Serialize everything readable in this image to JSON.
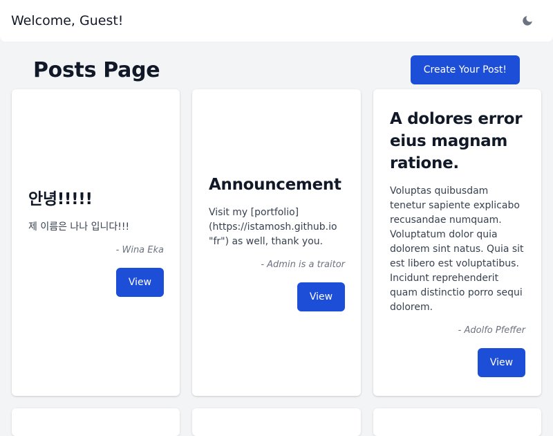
{
  "header": {
    "welcome": "Welcome, Guest!",
    "theme_icon": "moon-icon"
  },
  "page": {
    "title": "Posts Page",
    "create_button": "Create Your Post!"
  },
  "posts": [
    {
      "title": "안녕!!!!!",
      "body": "제 이름은 나나 입니다!!!",
      "author": "- Wina Eka",
      "view_label": "View"
    },
    {
      "title": "Announcement",
      "body": "Visit my [portfolio](https://istamosh.github.io \"fr\") as well, thank you.",
      "author": "- Admin is a traitor",
      "view_label": "View"
    },
    {
      "title": "A dolores error eius magnam ratione.",
      "body": "Voluptas quibusdam tenetur sapiente explicabo recusandae numquam. Voluptatum dolor quia dolorem sint natus. Quia sit est libero est voluptatibus. Incidunt reprehenderit quam distinctio porro sequi dolorem.",
      "author": "- Adolfo Pfeffer",
      "view_label": "View"
    }
  ],
  "colors": {
    "accent": "#1d4ed8",
    "background": "#f3f4f6",
    "card": "#ffffff"
  }
}
